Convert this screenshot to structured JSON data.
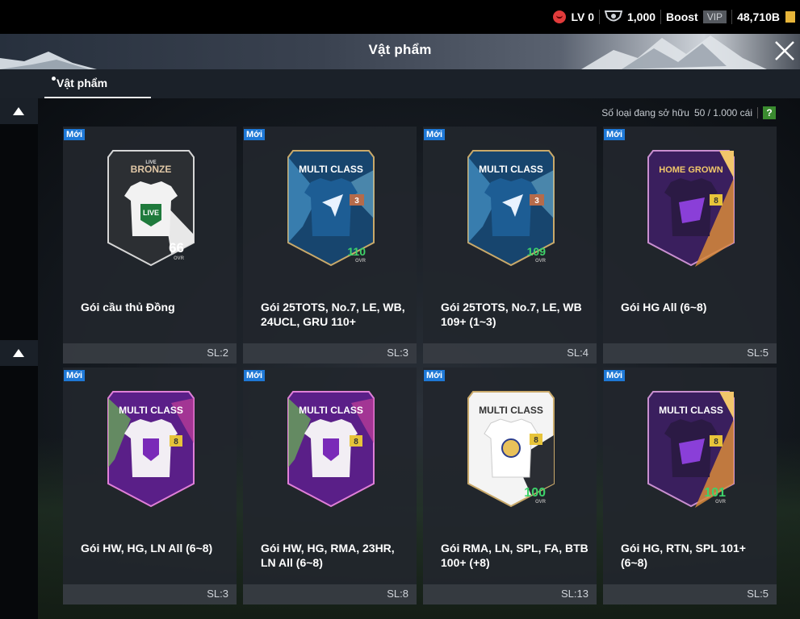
{
  "header": {
    "level_label": "LV 0",
    "shield_count": "1,000",
    "boost_label": "Boost",
    "vip_label": "VIP",
    "currency_amount": "48,710B"
  },
  "page": {
    "title": "Vật phẩm"
  },
  "tabs": [
    {
      "label": "Vật phẩm",
      "active": true
    }
  ],
  "inventory": {
    "owned_label": "Số loại đang sở hữu",
    "owned_count": "50 / 1.000 cái",
    "help_label": "?"
  },
  "items": [
    {
      "badge": "Mới",
      "name": "Gói cầu thủ Đồng",
      "quantity": "SL:2",
      "card_title": "BRONZE",
      "card_subtitle": "LIVE",
      "ovr": "66",
      "ovr_label": "OVR"
    },
    {
      "badge": "Mới",
      "name": "Gói 25TOTS, No.7, LE, WB, 24UCL, GRU 110+",
      "quantity": "SL:3",
      "card_title": "MULTI CLASS",
      "ovr": "110",
      "ovr_label": "OVR",
      "tier": "3"
    },
    {
      "badge": "Mới",
      "name": "Gói 25TOTS, No.7, LE, WB 109+ (1~3)",
      "quantity": "SL:4",
      "card_title": "MULTI CLASS",
      "ovr": "109",
      "ovr_label": "OVR",
      "tier": "3"
    },
    {
      "badge": "Mới",
      "name": "Gói HG All (6~8)",
      "quantity": "SL:5",
      "card_title": "HOME GROWN",
      "tier": "8"
    },
    {
      "badge": "Mới",
      "name": "Gói HW, HG, LN All (6~8)",
      "quantity": "SL:3",
      "card_title": "MULTI CLASS",
      "tier": "8"
    },
    {
      "badge": "Mới",
      "name": "Gói HW, HG, RMA, 23HR, LN All (6~8)",
      "quantity": "SL:8",
      "card_title": "MULTI CLASS",
      "tier": "8"
    },
    {
      "badge": "Mới",
      "name": "Gói RMA, LN, SPL, FA, BTB 100+ (+8)",
      "quantity": "SL:13",
      "card_title": "MULTI CLASS",
      "ovr": "100",
      "ovr_label": "OVR",
      "tier": "8"
    },
    {
      "badge": "Mới",
      "name": "Gói HG, RTN, SPL 101+ (6~8)",
      "quantity": "SL:5",
      "card_title": "MULTI CLASS",
      "ovr": "101",
      "ovr_label": "OVR",
      "tier": "8"
    }
  ],
  "colors": {
    "new_badge": "#1e78d6",
    "help_button": "#3a8b2f",
    "level_icon": "#e23b3b",
    "ovr_green": "#3ed36a"
  }
}
